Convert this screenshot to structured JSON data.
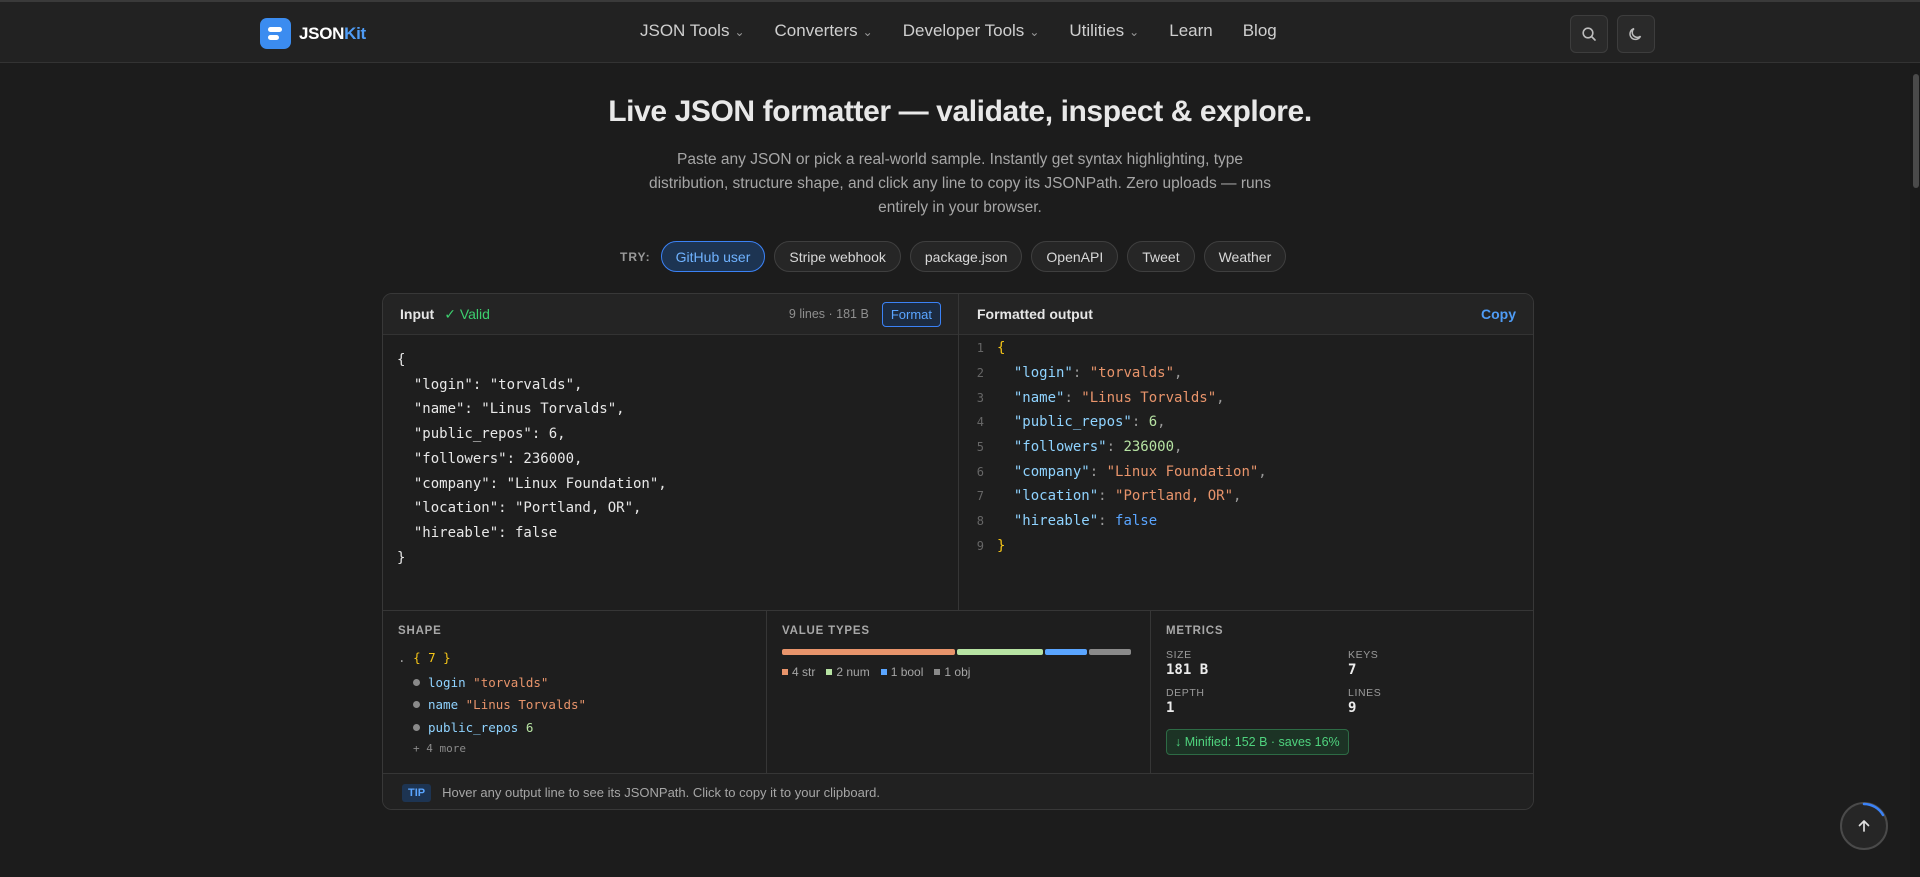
{
  "brand": {
    "name_main": "JSON",
    "name_accent": "Kit"
  },
  "nav": [
    {
      "label": "JSON Tools",
      "dropdown": true
    },
    {
      "label": "Converters",
      "dropdown": true
    },
    {
      "label": "Developer Tools",
      "dropdown": true
    },
    {
      "label": "Utilities",
      "dropdown": true
    },
    {
      "label": "Learn",
      "dropdown": false
    },
    {
      "label": "Blog",
      "dropdown": false
    }
  ],
  "header_icons": {
    "search": "search-icon",
    "theme": "moon-icon"
  },
  "hero": {
    "title": "Live JSON formatter — validate, inspect & explore.",
    "subtitle": "Paste any JSON or pick a real-world sample. Instantly get syntax highlighting, type distribution, structure shape, and click any line to copy its JSONPath. Zero uploads — runs entirely in your browser."
  },
  "samples": {
    "label": "TRY:",
    "items": [
      "GitHub user",
      "Stripe webhook",
      "package.json",
      "OpenAPI",
      "Tweet",
      "Weather"
    ],
    "active": "GitHub user"
  },
  "input_pane": {
    "title": "Input",
    "status": "✓ Valid",
    "meta": "9 lines · 181 B",
    "format_label": "Format",
    "code": "{\n  \"login\": \"torvalds\",\n  \"name\": \"Linus Torvalds\",\n  \"public_repos\": 6,\n  \"followers\": 236000,\n  \"company\": \"Linux Foundation\",\n  \"location\": \"Portland, OR\",\n  \"hireable\": false\n}"
  },
  "output_pane": {
    "title": "Formatted output",
    "copy_label": "Copy",
    "lines": [
      {
        "num": "1",
        "tokens": [
          {
            "t": "{",
            "c": "br"
          }
        ]
      },
      {
        "num": "2",
        "tokens": [
          {
            "t": "  "
          },
          {
            "t": "\"login\"",
            "c": "k"
          },
          {
            "t": ": ",
            "c": "p"
          },
          {
            "t": "\"torvalds\"",
            "c": "s"
          },
          {
            "t": ",",
            "c": "p"
          }
        ]
      },
      {
        "num": "3",
        "tokens": [
          {
            "t": "  "
          },
          {
            "t": "\"name\"",
            "c": "k"
          },
          {
            "t": ": ",
            "c": "p"
          },
          {
            "t": "\"Linus Torvalds\"",
            "c": "s"
          },
          {
            "t": ",",
            "c": "p"
          }
        ]
      },
      {
        "num": "4",
        "tokens": [
          {
            "t": "  "
          },
          {
            "t": "\"public_repos\"",
            "c": "k"
          },
          {
            "t": ": ",
            "c": "p"
          },
          {
            "t": "6",
            "c": "n"
          },
          {
            "t": ",",
            "c": "p"
          }
        ]
      },
      {
        "num": "5",
        "tokens": [
          {
            "t": "  "
          },
          {
            "t": "\"followers\"",
            "c": "k"
          },
          {
            "t": ": ",
            "c": "p"
          },
          {
            "t": "236000",
            "c": "n"
          },
          {
            "t": ",",
            "c": "p"
          }
        ]
      },
      {
        "num": "6",
        "tokens": [
          {
            "t": "  "
          },
          {
            "t": "\"company\"",
            "c": "k"
          },
          {
            "t": ": ",
            "c": "p"
          },
          {
            "t": "\"Linux Foundation\"",
            "c": "s"
          },
          {
            "t": ",",
            "c": "p"
          }
        ]
      },
      {
        "num": "7",
        "tokens": [
          {
            "t": "  "
          },
          {
            "t": "\"location\"",
            "c": "k"
          },
          {
            "t": ": ",
            "c": "p"
          },
          {
            "t": "\"Portland, OR\"",
            "c": "s"
          },
          {
            "t": ",",
            "c": "p"
          }
        ]
      },
      {
        "num": "8",
        "tokens": [
          {
            "t": "  "
          },
          {
            "t": "\"hireable\"",
            "c": "k"
          },
          {
            "t": ": ",
            "c": "p"
          },
          {
            "t": "false",
            "c": "b"
          }
        ]
      },
      {
        "num": "9",
        "tokens": [
          {
            "t": "}",
            "c": "br"
          }
        ]
      }
    ]
  },
  "shape": {
    "title": "SHAPE",
    "root_prefix": ".",
    "root": "{ 7 }",
    "items": [
      {
        "key": "login",
        "value": "\"torvalds\"",
        "kind": "s"
      },
      {
        "key": "name",
        "value": "\"Linus Torvalds\"",
        "kind": "s"
      },
      {
        "key": "public_repos",
        "value": "6",
        "kind": "n"
      }
    ],
    "more": "+ 4 more"
  },
  "value_types": {
    "title": "VALUE TYPES",
    "types": [
      {
        "label": "4 str",
        "count": 4,
        "color": "#e8946b"
      },
      {
        "label": "2 num",
        "count": 2,
        "color": "#b7e3a3"
      },
      {
        "label": "1 bool",
        "count": 1,
        "color": "#5aa5ff"
      },
      {
        "label": "1 obj",
        "count": 1,
        "color": "#8a8a8a"
      }
    ]
  },
  "metrics": {
    "title": "METRICS",
    "size": {
      "label": "SIZE",
      "value": "181 B"
    },
    "keys": {
      "label": "KEYS",
      "value": "7"
    },
    "depth": {
      "label": "DEPTH",
      "value": "1"
    },
    "lines": {
      "label": "LINES",
      "value": "9"
    },
    "minified": "↓ Minified: 152 B · saves 16%"
  },
  "tip": {
    "badge": "TIP",
    "text": "Hover any output line to see its JSONPath. Click to copy it to your clipboard."
  },
  "colors": {
    "accent": "#3b8cf0",
    "background": "#1c1c1c",
    "valid": "#3ccf6e"
  }
}
